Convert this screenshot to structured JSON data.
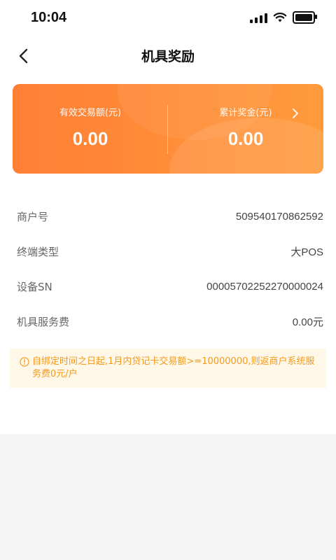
{
  "status": {
    "time": "10:04"
  },
  "nav": {
    "title": "机具奖励"
  },
  "summary": {
    "left_label": "有效交易额(元)",
    "left_value": "0.00",
    "right_label": "累计奖金(元)",
    "right_value": "0.00"
  },
  "details": [
    {
      "label": "商户号",
      "value": "509540170862592"
    },
    {
      "label": "终端类型",
      "value": "大POS"
    },
    {
      "label": "设备SN",
      "value": "00005702252270000024"
    },
    {
      "label": "机具服务费",
      "value": "0.00元"
    }
  ],
  "notice": {
    "text": "自绑定时间之日起,1月内贷记卡交易额>=10000000,则返商户系统服务费0元/户"
  },
  "colors": {
    "card_gradient_start": "#ff7f35",
    "card_gradient_end": "#ff9a3c",
    "notice_bg": "#fff8e8",
    "notice_text": "#f29a1f"
  }
}
